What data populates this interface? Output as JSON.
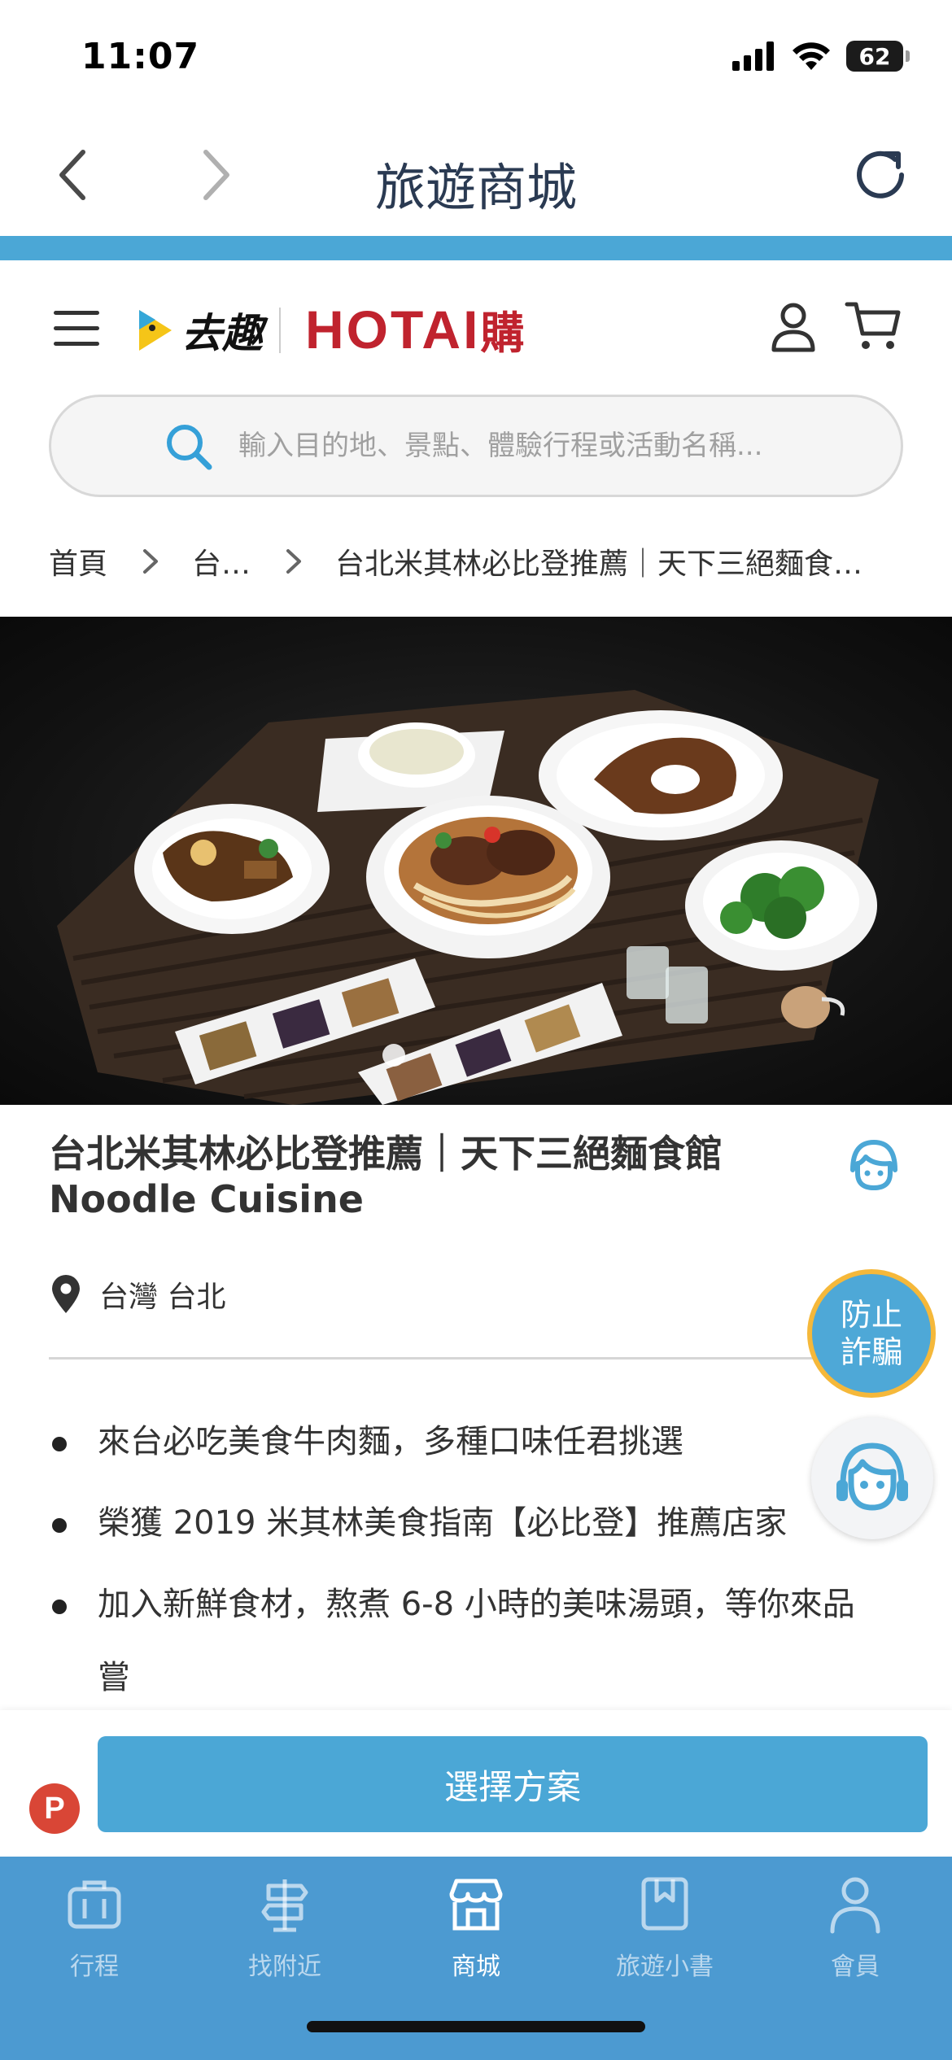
{
  "status_bar": {
    "time": "11:07",
    "battery": "62"
  },
  "browser": {
    "title": "旅遊商城"
  },
  "site_header": {
    "logo_quqi": "去趣",
    "logo_hotai": "HOTAI",
    "logo_hotai_suffix": "購"
  },
  "search": {
    "placeholder": "輸入目的地、景點、體驗行程或活動名稱..."
  },
  "breadcrumb": {
    "items": [
      "首頁",
      "台…",
      "台北米其林必比登推薦｜天下三絕麵食…"
    ]
  },
  "product": {
    "title": "台北米其林必比登推薦｜天下三絕麵食館 Noodle Cuisine",
    "location": "台灣 台北",
    "features": [
      "來台必吃美食牛肉麵，多種口味任君挑選",
      "榮獲 2019 米其林美食指南【必比登】推薦店家",
      "加入新鮮食材，熬煮 6-8 小時的美味湯頭，等你來品",
      "嘗"
    ]
  },
  "floating": {
    "anti_fraud_line1": "防止",
    "anti_fraud_line2": "詐騙"
  },
  "action_bar": {
    "points_badge": "P",
    "select_plan_label": "選擇方案"
  },
  "tab_bar": {
    "tabs": [
      {
        "label": "行程",
        "icon": "briefcase-icon"
      },
      {
        "label": "找附近",
        "icon": "signpost-icon"
      },
      {
        "label": "商城",
        "icon": "store-icon"
      },
      {
        "label": "旅遊小書",
        "icon": "bookmark-book-icon"
      },
      {
        "label": "會員",
        "icon": "person-icon"
      }
    ],
    "active_index": 2
  },
  "colors": {
    "accent": "#4ba7d6",
    "tab_bar": "#4c9ad1",
    "brand_red": "#c0232e",
    "fraud_ring": "#f5b83a"
  }
}
